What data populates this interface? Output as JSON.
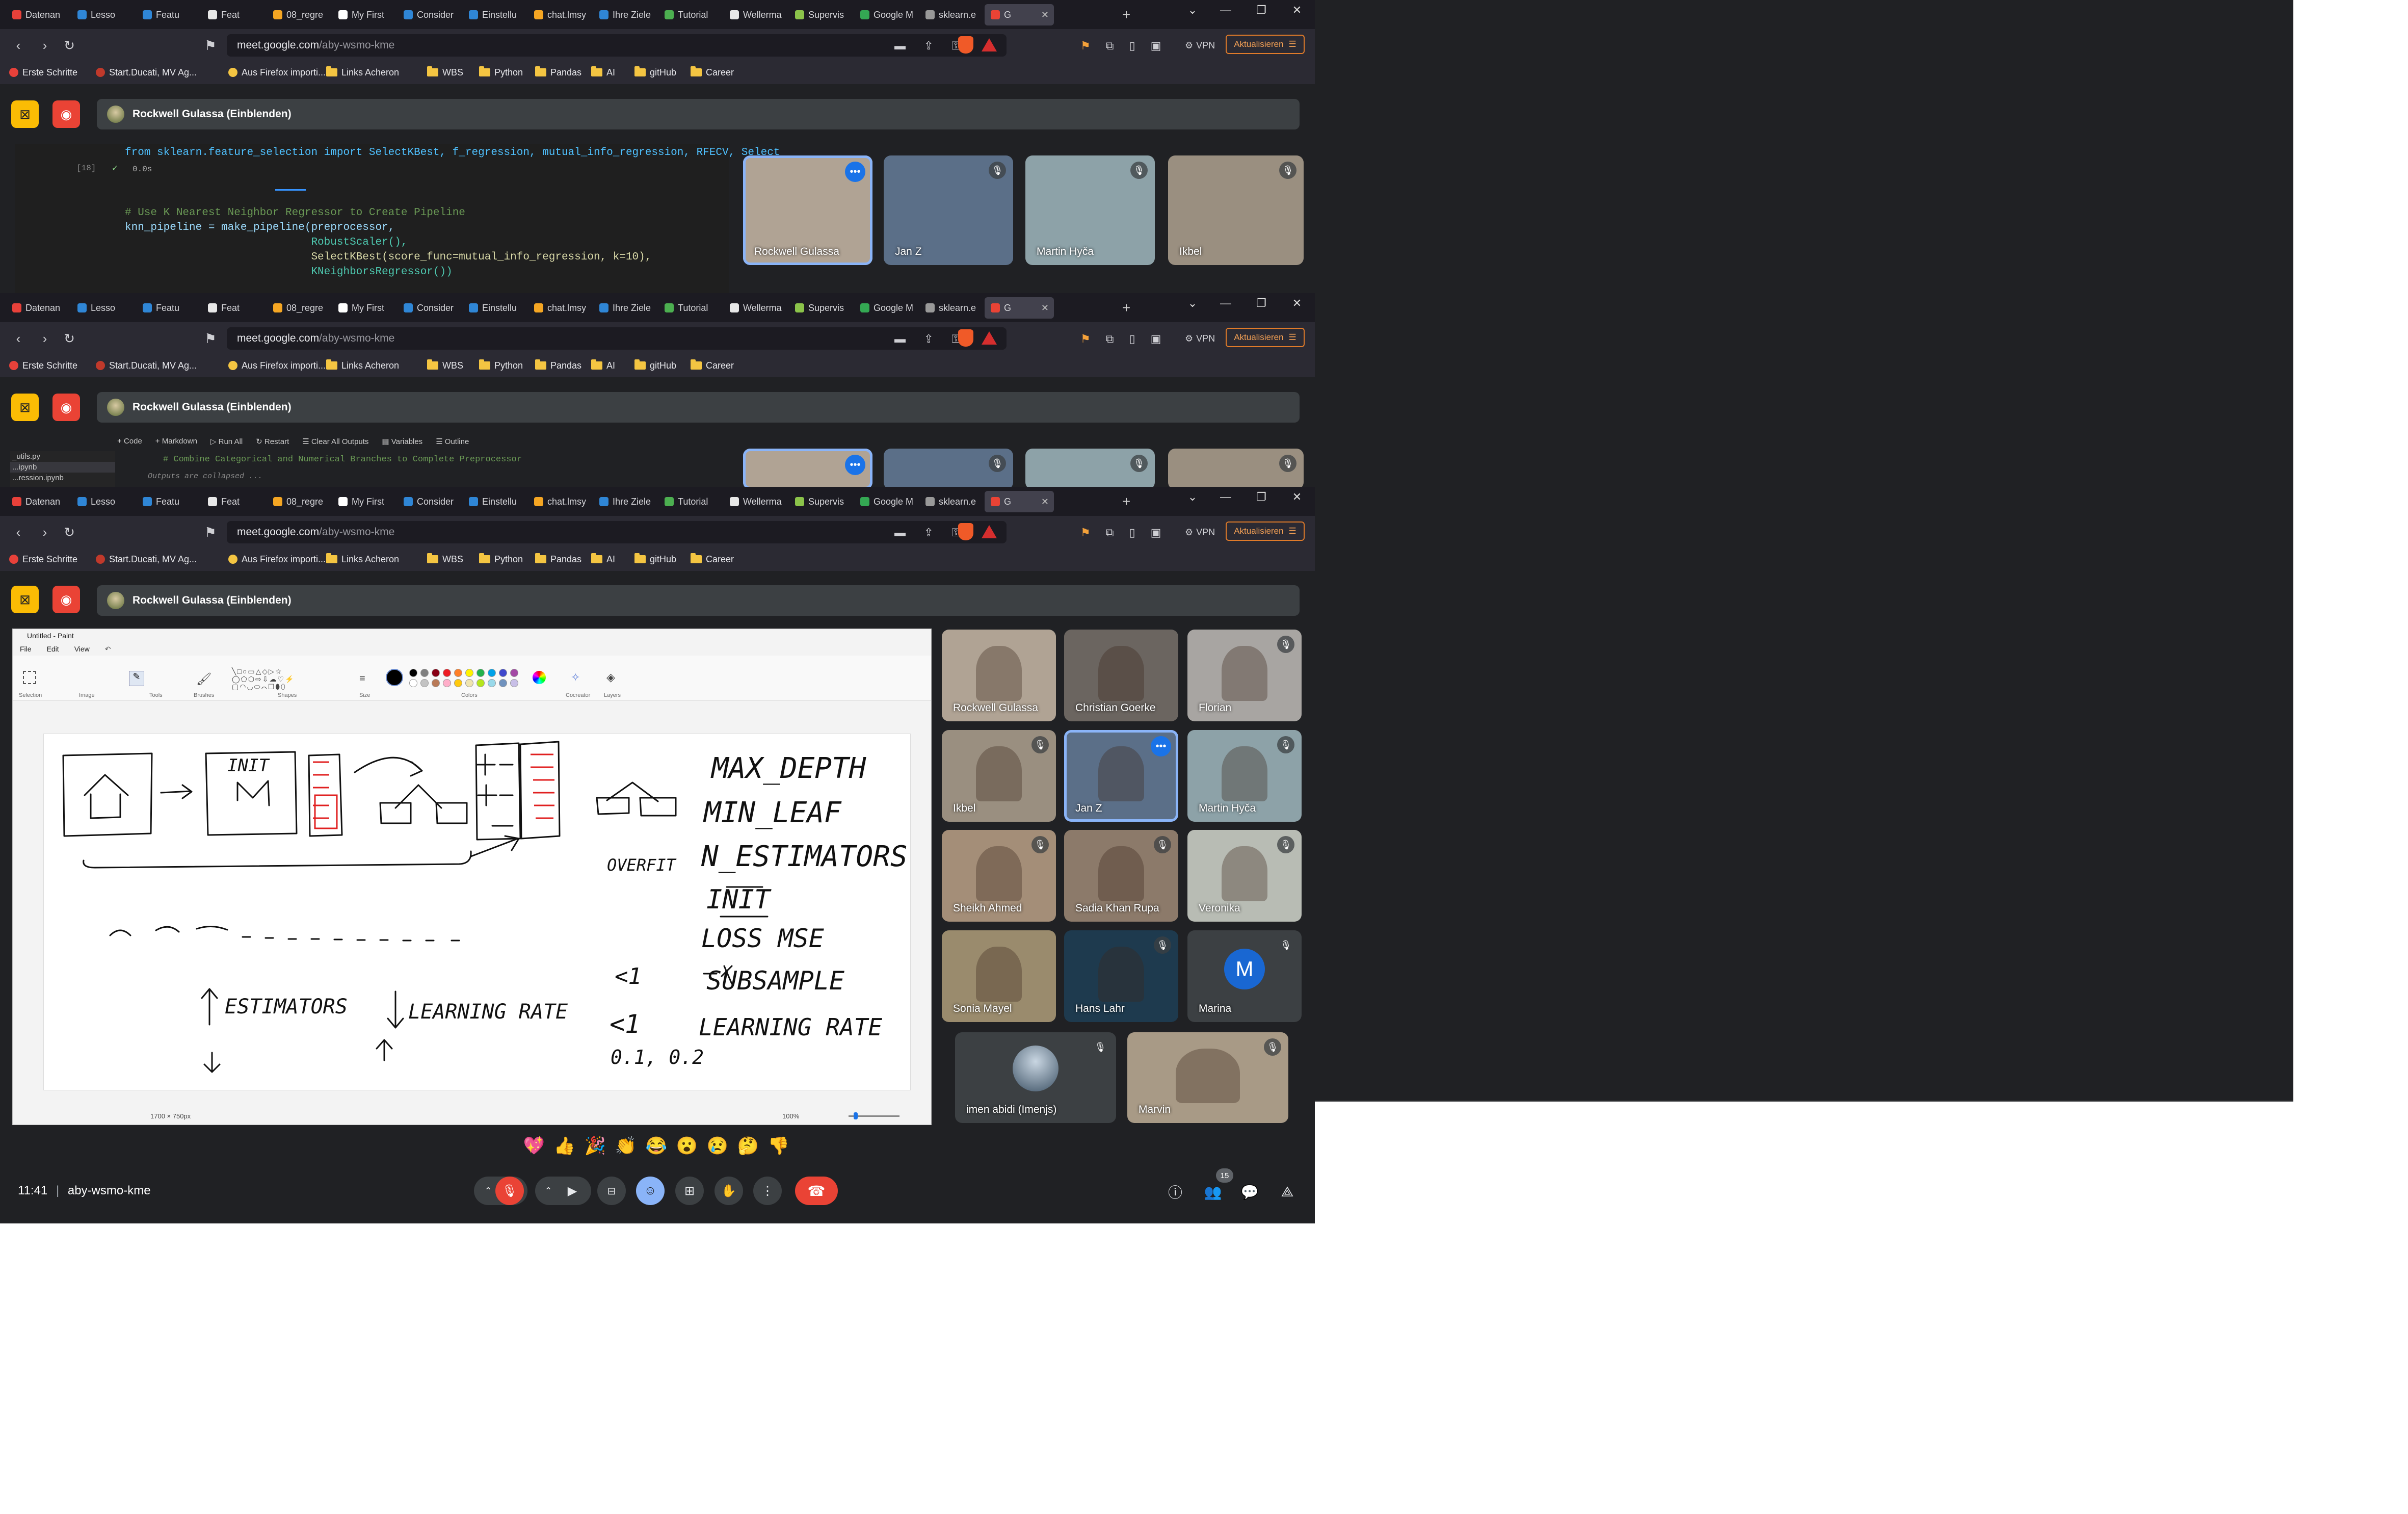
{
  "browser": {
    "tabs": [
      {
        "label": "Datenan",
        "color": "#e8413a"
      },
      {
        "label": "Lesso",
        "color": "#2f86d6"
      },
      {
        "label": "Featu",
        "color": "#2f86d6"
      },
      {
        "label": "Feat",
        "color": "#e8e8e8"
      },
      {
        "label": "08_regre",
        "color": "#f5a623"
      },
      {
        "label": "My First",
        "color": "#ffffff"
      },
      {
        "label": "Consider",
        "color": "#2f86d6"
      },
      {
        "label": "Einstellu",
        "color": "#2f86d6"
      },
      {
        "label": "chat.lmsy",
        "color": "#f5a623"
      },
      {
        "label": "Ihre Ziele",
        "color": "#2f86d6"
      },
      {
        "label": "Tutorial",
        "color": "#4caf50"
      },
      {
        "label": "Wellerma",
        "color": "#e8e8e8"
      },
      {
        "label": "Supervis",
        "color": "#8bc34a"
      },
      {
        "label": "Google M",
        "color": "#34a853"
      },
      {
        "label": "sklearn.e",
        "color": "#999999"
      },
      {
        "label": "G",
        "color": "#ea4335"
      }
    ],
    "url_host": "meet.google.com",
    "url_path": "/aby-wsmo-kme",
    "vpn_label": "VPN",
    "update_label": "Aktualisieren",
    "bookmarks": [
      "Erste Schritte",
      "Start.Ducati, MV Ag...",
      "Aus Firefox importi...",
      "Links Acheron",
      "WBS",
      "Python",
      "Pandas",
      "AI",
      "gitHub",
      "Career"
    ]
  },
  "meet": {
    "presenter_banner": "Rockwell Gulassa (Einblenden)",
    "meeting_code": "aby-wsmo-kme",
    "time": "11:41",
    "participant_count": "15",
    "reactions": [
      "💖",
      "👍",
      "🎉",
      "👏",
      "😂",
      "😮",
      "😢",
      "🤔",
      "👎"
    ]
  },
  "frame1": {
    "cell_index": "[18]",
    "exec_time": "0.0s",
    "code_lines": [
      "from sklearn.feature_selection import SelectKBest, f_regression, mutual_info_regression, RFECV, Select",
      "# Use K Nearest Neighbor Regressor to Create Pipeline",
      "knn_pipeline = make_pipeline(preprocessor,",
      "                             RobustScaler(),",
      "                             SelectKBest(score_func=mutual_info_regression, k=10),",
      "                             KNeighborsRegressor())"
    ],
    "tiles": [
      "Rockwell Gulassa",
      "Jan Z",
      "Martin Hyča",
      "Ikbel"
    ]
  },
  "frame2": {
    "toolbar": [
      "+ Code",
      "+ Markdown",
      "▷ Run All",
      "↻ Restart",
      "☰ Clear All Outputs",
      "▦ Variables",
      "☰ Outline"
    ],
    "files": [
      "_utils.py",
      "...ipynb",
      "...ression.ipynb"
    ],
    "comment": "# Combine Categorical and Numerical Branches to Complete Preprocessor",
    "collapsed": "Outputs are collapsed ..."
  },
  "paint": {
    "title": "Untitled - Paint",
    "menu": [
      "File",
      "Edit",
      "View"
    ],
    "groups": [
      "Selection",
      "Image",
      "Tools",
      "Brushes",
      "Shapes",
      "Size",
      "Colors",
      "Cocreator",
      "Layers"
    ],
    "status_size": "1700 × 750px",
    "zoom": "100%",
    "palette": [
      "#000000",
      "#7f7f7f",
      "#880015",
      "#ed1c24",
      "#ff7f27",
      "#fff200",
      "#22b14c",
      "#00a2e8",
      "#3f48cc",
      "#a349a4",
      "#ffffff",
      "#c3c3c3",
      "#b97a57",
      "#ffaec9",
      "#ffc90e",
      "#efe4b0",
      "#b5e61d",
      "#99d9ea",
      "#7092be",
      "#c8bfe7"
    ],
    "handwriting": {
      "init_box": "INIT",
      "params": [
        "MAX_DEPTH",
        "MIN_LEAF",
        "N_ESTIMATORS",
        "INIT",
        "LOSS MSE",
        "SUBSAMPLE",
        "LEARNING RATE"
      ],
      "overfit": "OVERFIT",
      "lt1_a": "<1",
      "lt1_b": "<1",
      "lr_values": "0.1, 0.2",
      "estimators": "ESTIMATORS",
      "learning_rate": "LEARNING RATE"
    }
  },
  "participants": [
    {
      "name": "Rockwell Gulassa",
      "muted": false,
      "speaking": false,
      "bg": "#b0a394"
    },
    {
      "name": "Christian Goerke",
      "muted": false,
      "speaking": false,
      "bg": "#6b6560"
    },
    {
      "name": "Florian",
      "muted": true,
      "speaking": false,
      "bg": "#a8a5a2"
    },
    {
      "name": "Ikbel",
      "muted": true,
      "speaking": false,
      "bg": "#9a8f80"
    },
    {
      "name": "Jan Z",
      "muted": false,
      "speaking": true,
      "bg": "#5b6f88"
    },
    {
      "name": "Martin Hyča",
      "muted": true,
      "speaking": false,
      "bg": "#8da2a8"
    },
    {
      "name": "Sheikh Ahmed",
      "muted": true,
      "speaking": false,
      "bg": "#a48e78"
    },
    {
      "name": "Sadia Khan Rupa",
      "muted": true,
      "speaking": false,
      "bg": "#8c7a6a"
    },
    {
      "name": "Veronika",
      "muted": true,
      "speaking": false,
      "bg": "#b8bcb4"
    },
    {
      "name": "Sonia Mayel",
      "muted": false,
      "speaking": false,
      "bg": "#9a8b6d"
    },
    {
      "name": "Hans Lahr",
      "muted": true,
      "speaking": false,
      "bg": "#1e3a4e"
    },
    {
      "name": "Marina",
      "muted": true,
      "speaking": false,
      "bg": "#3c4043",
      "initial": "M"
    },
    {
      "name": "imen abidi (Imenjs)",
      "muted": true,
      "speaking": false,
      "bg": "#3c4043"
    },
    {
      "name": "Marvin",
      "muted": true,
      "speaking": false,
      "bg": "#a89a86"
    }
  ]
}
